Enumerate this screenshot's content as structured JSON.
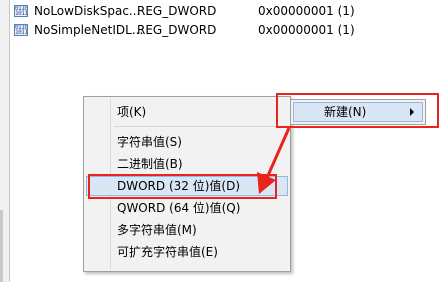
{
  "values_list": [
    {
      "name": "NoLowDiskSpac...",
      "type": "REG_DWORD",
      "data": "0x00000001 (1)",
      "icon": "binary-value-icon"
    },
    {
      "name": "NoSimpleNetIDL...",
      "type": "REG_DWORD",
      "data": "0x00000001 (1)",
      "icon": "binary-value-icon"
    }
  ],
  "icon_glyph": "0110\n1011",
  "new_menu": {
    "label": "新建(N)"
  },
  "submenu": {
    "items": [
      {
        "label": "项(K)"
      },
      {
        "label": "字符串值(S)"
      },
      {
        "label": "二进制值(B)"
      },
      {
        "label": "DWORD (32 位)值(D)"
      },
      {
        "label": "QWORD (64 位)值(Q)"
      },
      {
        "label": "多字符串值(M)"
      },
      {
        "label": "可扩充字符串值(E)"
      }
    ]
  },
  "colors": {
    "annotation_red": "#e8241c",
    "highlight": "#d9e6f5"
  }
}
